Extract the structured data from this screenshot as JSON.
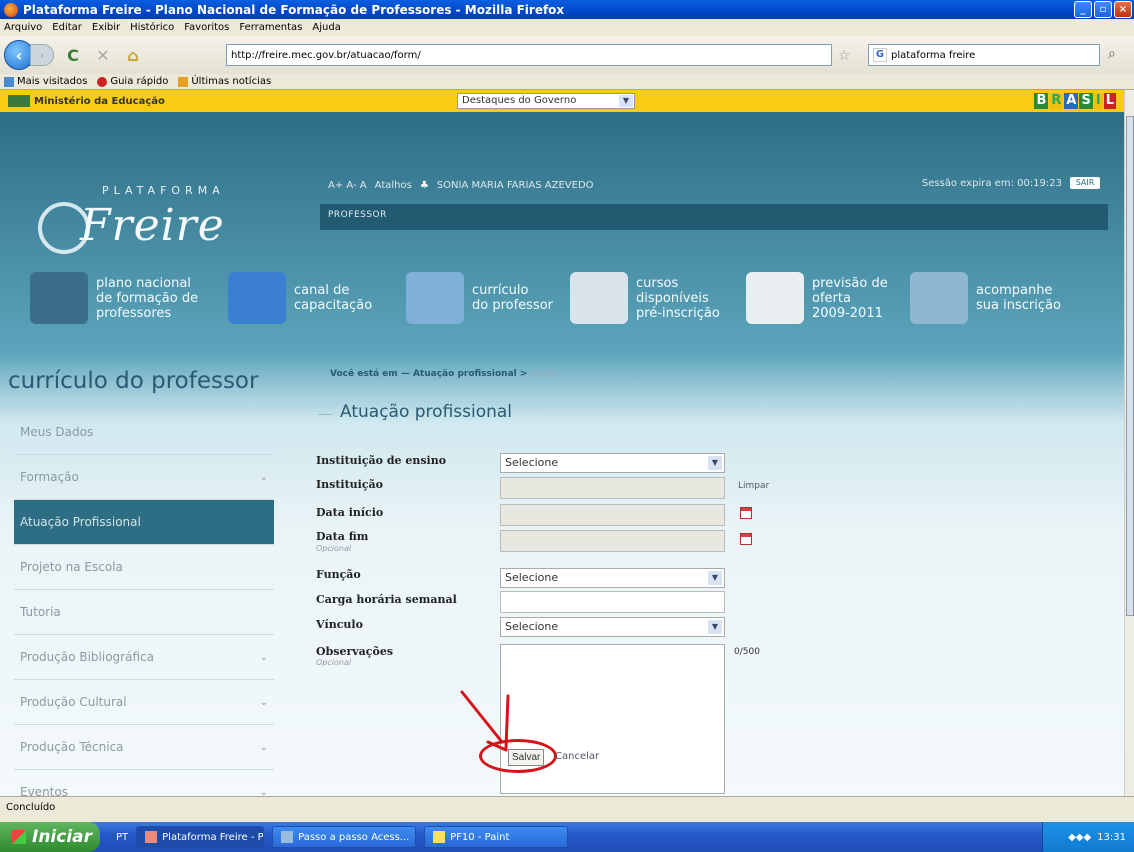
{
  "window": {
    "title": "Plataforma Freire - Plano Nacional de Formação de Professores - Mozilla Firefox"
  },
  "menubar": [
    "Arquivo",
    "Editar",
    "Exibir",
    "Histórico",
    "Favoritos",
    "Ferramentas",
    "Ajuda"
  ],
  "navbar": {
    "url": "http://freire.mec.gov.br/atuacao/form/",
    "search": "plataforma freire"
  },
  "bookmarks": [
    "Mais visitados",
    "Guia rápido",
    "Últimas notícias"
  ],
  "govbar": {
    "ministry": "Ministério da Educação",
    "select": "Destaques do Governo",
    "brasil": [
      "B",
      "R",
      "A",
      "S",
      "I",
      "L"
    ]
  },
  "header": {
    "logo_top": "PLATAFORMA",
    "logo_main": "Freire",
    "font_size": "A+ A- A",
    "atalhos": "Atalhos",
    "user": "SONIA MARIA FARIAS AZEVEDO",
    "session": "Sessão expira em: 00:19:23",
    "sair": "SAIR",
    "role": "PROFESSOR"
  },
  "bignav": [
    {
      "l1": "plano nacional",
      "l2": "de formação de",
      "l3": "professores",
      "color": "#3a6e8a"
    },
    {
      "l1": "",
      "l2": "canal de",
      "l3": "capacitação",
      "color": "#3b7fd0"
    },
    {
      "l1": "",
      "l2": "currículo",
      "l3": "do professor",
      "color": "#7fb0d8"
    },
    {
      "l1": "cursos",
      "l2": "disponíveis",
      "l3": "pré-inscrição",
      "color": "#d9e4ec"
    },
    {
      "l1": "previsão de",
      "l2": "oferta",
      "l3": "2009-2011",
      "color": "#e8eef2"
    },
    {
      "l1": "",
      "l2": "acompanhe",
      "l3": "sua inscrição",
      "color": "#8fb8d0"
    }
  ],
  "sidebar": {
    "title": "currículo do professor",
    "items": [
      {
        "label": "Meus Dados",
        "chev": ""
      },
      {
        "label": "Formação",
        "chev": "⌄"
      },
      {
        "label": "Atuação Profissional",
        "chev": ""
      },
      {
        "label": "Projeto na Escola",
        "chev": ""
      },
      {
        "label": "Tutoria",
        "chev": ""
      },
      {
        "label": "Produção Bibliográfica",
        "chev": "⌄"
      },
      {
        "label": "Produção Cultural",
        "chev": "⌄"
      },
      {
        "label": "Produção Técnica",
        "chev": "⌄"
      },
      {
        "label": "Eventos",
        "chev": "⌄"
      }
    ]
  },
  "breadcrumb": {
    "prefix": "Você está em",
    "sep": "—",
    "section": "Atuação profissional",
    "arrow": ">",
    "current": "Incluir"
  },
  "form": {
    "title": "Atuação profissional",
    "optional": "Opcional",
    "fields": {
      "tipo_instituicao": {
        "label": "Instituição de ensino",
        "value": "Selecione"
      },
      "instituicao": {
        "label": "Instituição",
        "value": ""
      },
      "data_inicio": {
        "label": "Data início",
        "value": ""
      },
      "data_fim": {
        "label": "Data fim",
        "value": ""
      },
      "funcao": {
        "label": "Função",
        "value": "Selecione"
      },
      "carga": {
        "label": "Carga horária semanal",
        "value": ""
      },
      "vinculo": {
        "label": "Vínculo",
        "value": "Selecione"
      },
      "observacoes": {
        "label": "Observações",
        "value": "",
        "counter": "0/500"
      }
    },
    "limpar": "Limpar",
    "salvar": "Salvar",
    "cancelar": "Cancelar"
  },
  "statusbar": "Concluído",
  "taskbar": {
    "start": "Iniciar",
    "lang": "PT",
    "tasks": [
      "Plataforma Freire - Pl...",
      "Passo a passo Acess...",
      "PF10 - Paint"
    ],
    "clock": "13:31"
  }
}
